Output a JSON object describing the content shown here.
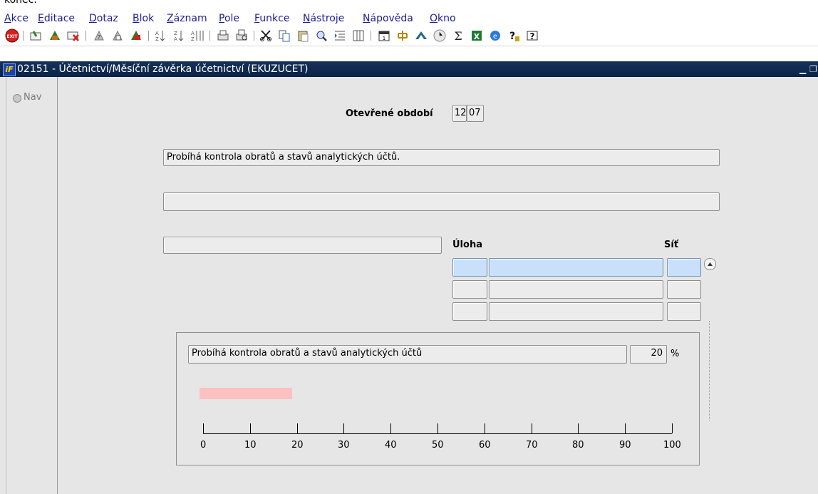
{
  "top_clip": "konec.",
  "menu": [
    "Akce",
    "Editace",
    "Dotaz",
    "Blok",
    "Záznam",
    "Pole",
    "Funkce",
    "Nástroje",
    "Nápověda",
    "Okno"
  ],
  "window": {
    "title": "02151 - Účetnictví/Měsíční závěrka účetnictví (EKUZUCET)"
  },
  "nav": {
    "label": "Nav"
  },
  "period": {
    "label": "Otevřené období",
    "month": "12",
    "year": "07"
  },
  "status_line_1": "Probíhá kontrola obratů a stavů analytických účtů.",
  "status_line_2": "",
  "status_line_3": "",
  "grid": {
    "col_task": "Úloha",
    "col_net": "Síť"
  },
  "progress": {
    "message": "Probíhá kontrola obratů a stavů analytických účtů",
    "percent": "20",
    "percent_unit": "%",
    "fraction": 0.2,
    "ticks": [
      "0",
      "10",
      "20",
      "30",
      "40",
      "50",
      "60",
      "70",
      "80",
      "90",
      "100"
    ],
    "bar_color": "#ffc0c0"
  },
  "colors": {
    "title_bar": "#16325c",
    "field_selected": "#c8e0fa",
    "workspace": "#e6e6e6"
  }
}
